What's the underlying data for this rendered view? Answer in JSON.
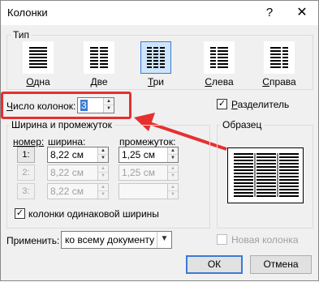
{
  "window": {
    "title": "Колонки",
    "help": "?",
    "close": "✕"
  },
  "type_group": {
    "label": "Тип",
    "presets": [
      {
        "label": "Одна",
        "underline": "О",
        "rest": "дна"
      },
      {
        "label": "Две",
        "underline": "Д",
        "rest": "ве"
      },
      {
        "label": "Три",
        "underline": "Т",
        "rest": "ри"
      },
      {
        "label": "Слева",
        "underline": "С",
        "rest": "лева"
      },
      {
        "label": "Справа",
        "underline": "С",
        "rest": "права"
      }
    ],
    "selected": "Три"
  },
  "num_columns": {
    "label": "Число колонок:",
    "underline": "Ч",
    "rest": "исло колонок:",
    "value": "3"
  },
  "separator": {
    "label": "Разделитель",
    "underline": "Р",
    "rest": "азделитель",
    "checked": true
  },
  "width_spacing": {
    "label": "Ширина и промежуток",
    "headers": {
      "number": "номер:",
      "width": "ширина:",
      "spacing": "промежуток:"
    },
    "rows": [
      {
        "num": "1:",
        "width": "8,22 см",
        "spacing": "1,25 см",
        "enabled": true
      },
      {
        "num": "2:",
        "width": "8,22 см",
        "spacing": "1,25 см",
        "enabled": false
      },
      {
        "num": "3:",
        "width": "8,22 см",
        "spacing": "",
        "enabled": false
      }
    ],
    "equal_width": {
      "label": "колонки одинаковой ширины",
      "checked": true
    }
  },
  "preview": {
    "label": "Образец"
  },
  "apply": {
    "label": "Применить:",
    "value": "ко всему документу"
  },
  "new_column": {
    "label": "Новая колонка",
    "checked": false
  },
  "buttons": {
    "ok": "ОК",
    "cancel": "Отмена"
  },
  "annotation_color": "#e53030"
}
